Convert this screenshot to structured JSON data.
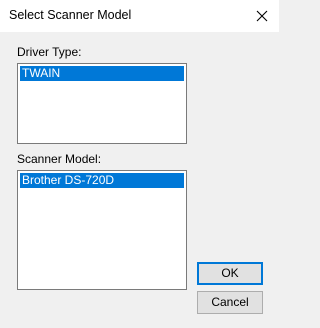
{
  "window": {
    "title": "Select Scanner Model",
    "close_icon": "close-icon"
  },
  "driver_type": {
    "label": "Driver Type:",
    "items": [
      {
        "label": "TWAIN",
        "selected": true
      }
    ]
  },
  "scanner_model": {
    "label": "Scanner Model:",
    "items": [
      {
        "label": "Brother DS-720D",
        "selected": true
      }
    ]
  },
  "buttons": {
    "ok_label": "OK",
    "cancel_label": "Cancel"
  },
  "colors": {
    "selection": "#0078d7",
    "window_bg": "#f0f0f0"
  }
}
